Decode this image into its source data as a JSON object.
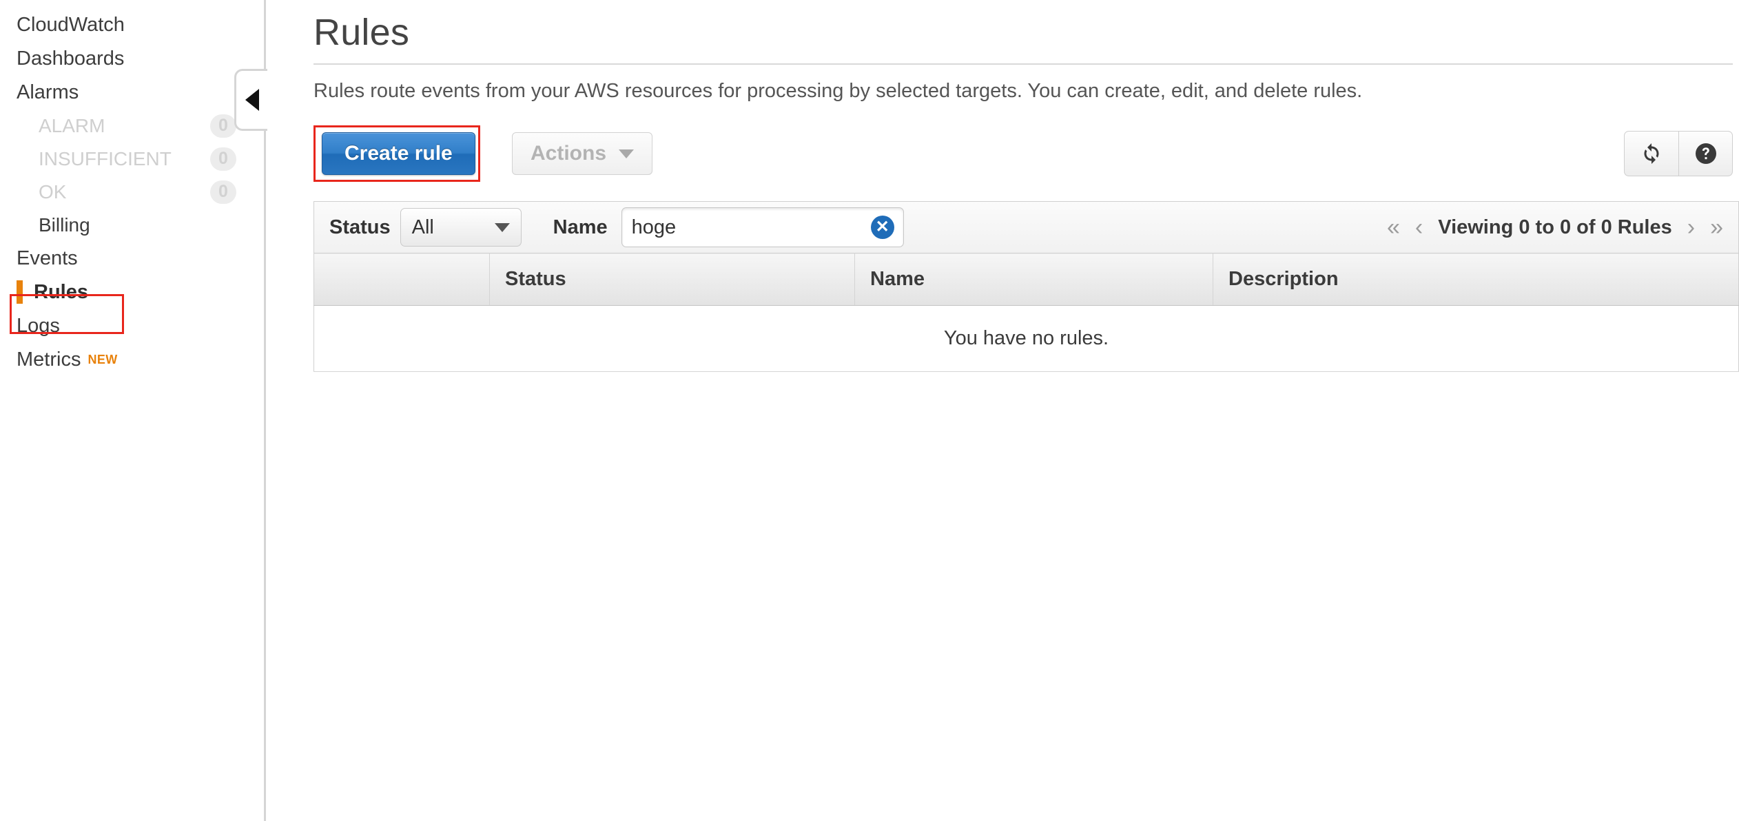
{
  "sidebar": {
    "items": [
      {
        "label": "CloudWatch",
        "type": "top"
      },
      {
        "label": "Dashboards",
        "type": "top"
      },
      {
        "label": "Alarms",
        "type": "top"
      },
      {
        "label": "ALARM",
        "type": "sub",
        "count": "0"
      },
      {
        "label": "INSUFFICIENT",
        "type": "sub",
        "count": "0"
      },
      {
        "label": "OK",
        "type": "sub",
        "count": "0"
      },
      {
        "label": "Billing",
        "type": "sub-active"
      },
      {
        "label": "Events",
        "type": "top"
      },
      {
        "label": "Rules",
        "type": "selected"
      },
      {
        "label": "Logs",
        "type": "top"
      },
      {
        "label": "Metrics",
        "type": "top",
        "badge": "NEW"
      }
    ],
    "collapse_tooltip": "collapse-sidebar",
    "accent_color": "#e8820c",
    "annotation_color": "#e8261c"
  },
  "header": {
    "title": "Rules",
    "description": "Rules route events from your AWS resources for processing by selected targets. You can create, edit, and delete rules."
  },
  "toolbar": {
    "create_label": "Create rule",
    "actions_label": "Actions",
    "refresh_icon": "refresh-icon",
    "help_icon": "help-icon",
    "create_button_color": "#2a76c0"
  },
  "filter": {
    "status_label": "Status",
    "status_value": "All",
    "status_options": [
      "All"
    ],
    "name_label": "Name",
    "name_value": "hoge",
    "name_placeholder": "",
    "clear_icon": "clear-icon"
  },
  "pagination": {
    "first": "«",
    "prev": "‹",
    "text": "Viewing 0 to 0 of 0 Rules",
    "next": "›",
    "last": "»"
  },
  "table": {
    "columns": [
      "",
      "Status",
      "Name",
      "Description"
    ],
    "rows": [],
    "empty_message": "You have no rules."
  }
}
